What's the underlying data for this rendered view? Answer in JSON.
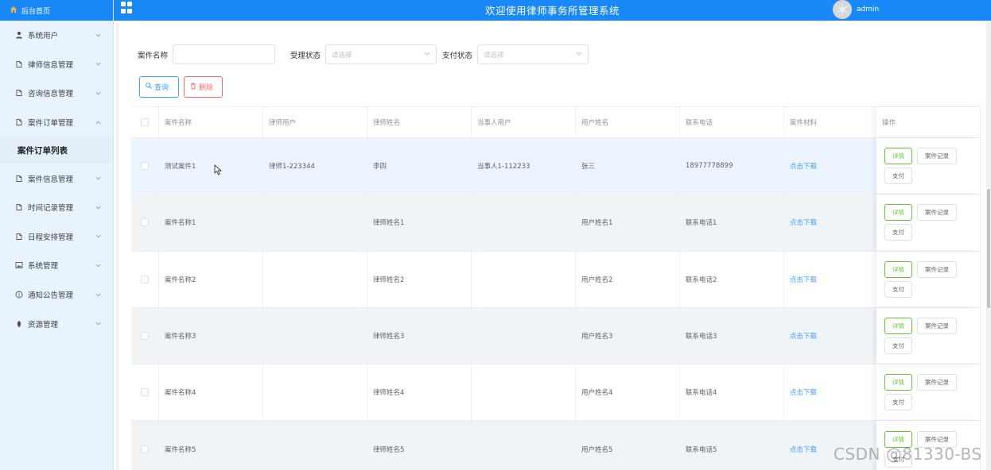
{
  "header": {
    "title": "欢迎使用律师事务所管理系统",
    "username": "admin"
  },
  "sidebar": {
    "home_label": "后台首页",
    "items": [
      {
        "label": "系统用户",
        "icon": "user-icon",
        "expanded": false
      },
      {
        "label": "律师信息管理",
        "icon": "doc-icon",
        "expanded": false
      },
      {
        "label": "咨询信息管理",
        "icon": "doc-icon",
        "expanded": false
      },
      {
        "label": "案件订单管理",
        "icon": "doc-icon",
        "expanded": true
      },
      {
        "label": "案件信息管理",
        "icon": "doc-icon",
        "expanded": false
      },
      {
        "label": "时间记录管理",
        "icon": "doc-icon",
        "expanded": false
      },
      {
        "label": "日程安排管理",
        "icon": "doc-icon",
        "expanded": false
      },
      {
        "label": "系统管理",
        "icon": "picture-icon",
        "expanded": false
      },
      {
        "label": "通知公告管理",
        "icon": "info-icon",
        "expanded": false
      },
      {
        "label": "资源管理",
        "icon": "location-icon",
        "expanded": false
      }
    ],
    "active_sub": "案件订单列表"
  },
  "filters": {
    "name_label": "案件名称",
    "name_value": "",
    "status_label": "受理状态",
    "status_placeholder": "请选择",
    "pay_label": "支付状态",
    "pay_placeholder": "请选择"
  },
  "actions": {
    "query_label": "查询",
    "delete_label": "删除"
  },
  "table": {
    "columns": [
      "案件名称",
      "律师用户",
      "律师姓名",
      "当事人用户",
      "用户姓名",
      "联系电话",
      "案件材料",
      "操作"
    ],
    "rows": [
      {
        "name": "测试案件1",
        "lawyer_user": "律师1-223344",
        "lawyer_name": "李四",
        "client_user": "当事人1-112233",
        "user_name": "张三",
        "phone": "18977778899",
        "material": "点击下载"
      },
      {
        "name": "案件名称1",
        "lawyer_user": "",
        "lawyer_name": "律师姓名1",
        "client_user": "",
        "user_name": "用户姓名1",
        "phone": "联系电话1",
        "material": "点击下载"
      },
      {
        "name": "案件名称2",
        "lawyer_user": "",
        "lawyer_name": "律师姓名2",
        "client_user": "",
        "user_name": "用户姓名2",
        "phone": "联系电话2",
        "material": "点击下载"
      },
      {
        "name": "案件名称3",
        "lawyer_user": "",
        "lawyer_name": "律师姓名3",
        "client_user": "",
        "user_name": "用户姓名3",
        "phone": "联系电话3",
        "material": "点击下载"
      },
      {
        "name": "案件名称4",
        "lawyer_user": "",
        "lawyer_name": "律师姓名4",
        "client_user": "",
        "user_name": "用户姓名4",
        "phone": "联系电话4",
        "material": "点击下载"
      },
      {
        "name": "案件名称5",
        "lawyer_user": "",
        "lawyer_name": "律师姓名5",
        "client_user": "",
        "user_name": "用户姓名5",
        "phone": "联系电话5",
        "material": "点击下载"
      }
    ],
    "op_labels": {
      "detail": "详情",
      "record": "案件记录",
      "pay": "支付"
    }
  },
  "watermark": "CSDN @81330-BS",
  "colors": {
    "primary": "#1989fa",
    "sidebar_bg": "#e9f3fd",
    "danger": "#f56c6c",
    "success": "#67c23a",
    "link": "#409eff"
  }
}
